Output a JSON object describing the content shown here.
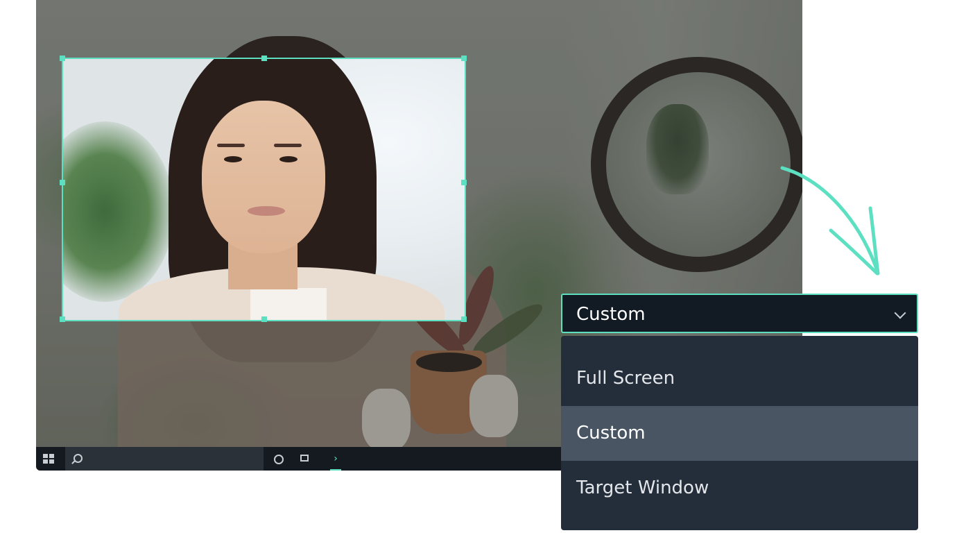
{
  "dropdown": {
    "selected": "Custom",
    "options": [
      "Full Screen",
      "Custom",
      "Target Window"
    ],
    "selected_index": 1
  },
  "taskbar": {
    "icons": [
      "windows-start-icon",
      "search-icon",
      "cortana-icon",
      "task-view-icon",
      "recorder-app-icon"
    ]
  },
  "colors": {
    "accent": "#5ce0c1",
    "dropdown_bg": "#121a23",
    "menu_bg": "#242e3a",
    "selected_bg": "#4a5563",
    "taskbar_bg": "#141a20"
  }
}
